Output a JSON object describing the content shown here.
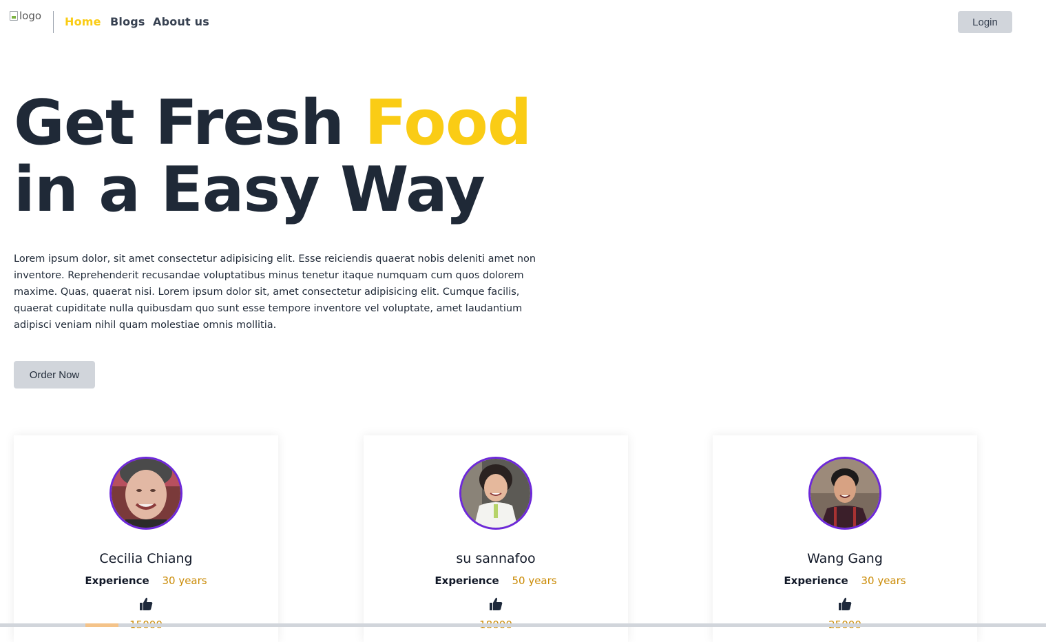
{
  "nav": {
    "logo_alt": "logo",
    "links": [
      "Home",
      "Blogs",
      "About us"
    ],
    "login_label": "Login"
  },
  "hero": {
    "title_part1": "Get Fresh ",
    "title_accent": "Food",
    "title_line2": "in a Easy Way",
    "description": "Lorem ipsum dolor, sit amet consectetur adipisicing elit. Esse reiciendis quaerat nobis deleniti amet non inventore. Reprehenderit recusandae voluptatibus minus tenetur itaque numquam cum quos dolorem maxime. Quas, quaerat nisi. Lorem ipsum dolor sit, amet consectetur adipisicing elit. Cumque facilis, quaerat cupiditate nulla quibusdam quo sunt esse tempore inventore vel voluptate, amet laudantium adipisci veniam nihil quam molestiae omnis mollitia.",
    "order_button": "Order Now"
  },
  "chefs": [
    {
      "name": "Cecilia Chiang",
      "experience_label": "Experience",
      "experience": "30 years",
      "likes": "15000"
    },
    {
      "name": "su sannafoo",
      "experience_label": "Experience",
      "experience": "50 years",
      "likes": "18000"
    },
    {
      "name": "Wang Gang",
      "experience_label": "Experience",
      "experience": "30 years",
      "likes": "25000"
    }
  ],
  "colors": {
    "accent": "#facc15",
    "avatar_border": "#6d28d9",
    "button_bg": "#d1d5db",
    "value": "#ca8a04"
  },
  "icons": {
    "thumb": "thumbs-up-icon"
  }
}
